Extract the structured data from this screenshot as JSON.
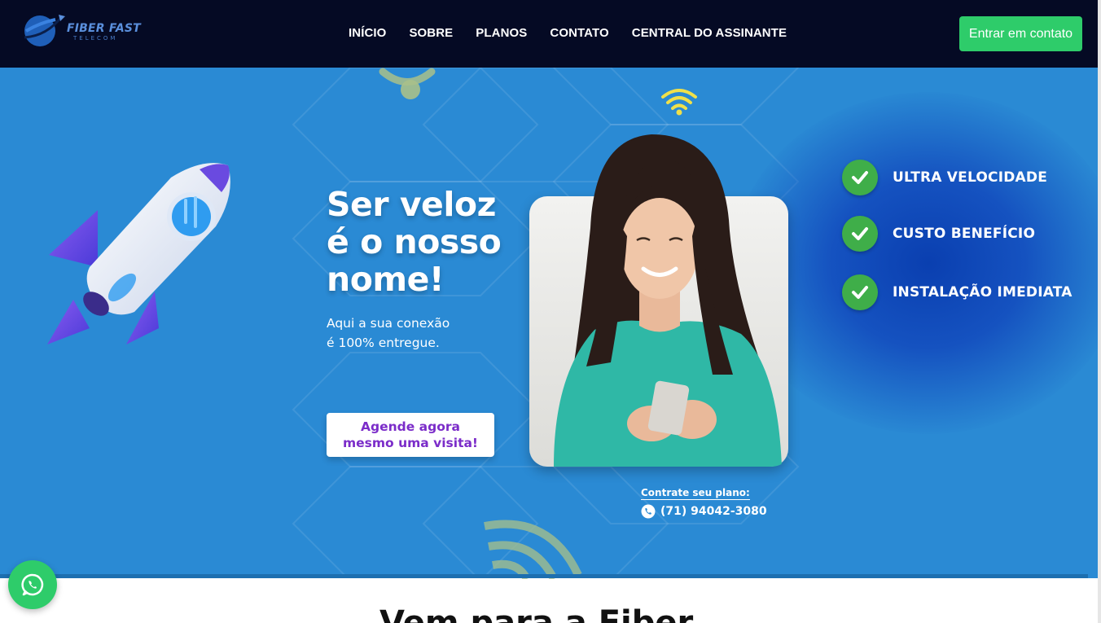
{
  "header": {
    "logo_text": "FIBER FAST",
    "logo_sub": "TELECOM",
    "nav": [
      "INÍCIO",
      "SOBRE",
      "PLANOS",
      "CONTATO",
      "CENTRAL DO ASSINANTE"
    ],
    "cta_label": "Entrar em contato"
  },
  "hero": {
    "headline": [
      "Ser veloz",
      "é o nosso",
      "nome!"
    ],
    "subtitle": [
      "Aqui a sua conexão",
      "é 100% entregue."
    ],
    "visit_button": [
      "Agende agora",
      "mesmo uma visita!"
    ],
    "contract_label": "Contrate seu plano:",
    "phone": "(71) 94042-3080",
    "features": [
      "ULTRA VELOCIDADE",
      "CUSTO BENEFÍCIO",
      "INSTALAÇÃO IMEDIATA"
    ]
  },
  "next_section": {
    "title_partial": "Vem para a Fiber"
  },
  "colors": {
    "header_bg": "#050a24",
    "hero_bg": "#2a8ad4",
    "cta_green": "#2ecc6a",
    "check_green": "#3fae49",
    "visit_text": "#7b2cc9"
  },
  "icons": [
    "rocket-illustration",
    "wifi-icon",
    "check-icon",
    "phone-icon",
    "whatsapp-icon"
  ]
}
